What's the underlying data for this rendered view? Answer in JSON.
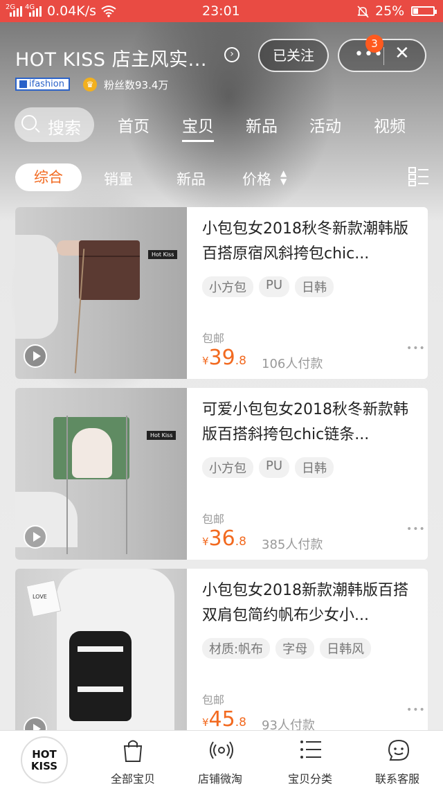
{
  "status_bar": {
    "sim1": "2G",
    "sim2": "4G",
    "net_speed": "0.04K/s",
    "time": "23:01",
    "battery": "25%",
    "battery_level": 0.25
  },
  "header": {
    "store_name": "HOT KISS 店主风实...",
    "follow_label": "已关注",
    "more_label": "•••",
    "close_label": "✕",
    "notification_count": "3",
    "ifashion_label": "ifashion",
    "fans_label": "粉丝数93.4万"
  },
  "nav": {
    "search_label": "搜索",
    "tabs": [
      {
        "label": "首页"
      },
      {
        "label": "宝贝",
        "active": true
      },
      {
        "label": "新品"
      },
      {
        "label": "活动"
      },
      {
        "label": "视频"
      }
    ]
  },
  "sort": {
    "items": [
      {
        "label": "综合",
        "active": true
      },
      {
        "label": "销量"
      },
      {
        "label": "新品"
      },
      {
        "label": "价格"
      }
    ]
  },
  "products": [
    {
      "title": "小包包女2018秋冬新款潮韩版百搭原宿风斜挎包chic...",
      "tags": [
        "小方包",
        "PU",
        "日韩"
      ],
      "shipping": "包邮",
      "currency": "¥",
      "price_int": "39",
      "price_dec": ".8",
      "buyers": "106人付款",
      "image_tag": "Hot Kiss"
    },
    {
      "title": "可爱小包包女2018秋冬新款韩版百搭斜挎包chic链条...",
      "tags": [
        "小方包",
        "PU",
        "日韩"
      ],
      "shipping": "包邮",
      "currency": "¥",
      "price_int": "36",
      "price_dec": ".8",
      "buyers": "385人付款",
      "image_tag": "Hot Kiss"
    },
    {
      "title": "小包包女2018新款潮韩版百搭双肩包简约帆布少女小...",
      "tags": [
        "材质:帆布",
        "字母",
        "日韩风"
      ],
      "shipping": "包邮",
      "currency": "¥",
      "price_int": "45",
      "price_dec": ".8",
      "buyers": "93人付款",
      "image_tag": "LOVE"
    }
  ],
  "tabbar": {
    "logo_line1": "HOT",
    "logo_line2": "KISS",
    "items": [
      {
        "label": "全部宝贝",
        "icon": "bag-icon"
      },
      {
        "label": "店铺微淘",
        "icon": "broadcast-icon"
      },
      {
        "label": "宝贝分类",
        "icon": "list-icon"
      },
      {
        "label": "联系客服",
        "icon": "chat-face-icon"
      }
    ]
  },
  "colors": {
    "status_bar": "#e94b43",
    "accent": "#f26a20",
    "badge": "#ff5a1f",
    "ifashion_blue": "#2a62c9"
  }
}
